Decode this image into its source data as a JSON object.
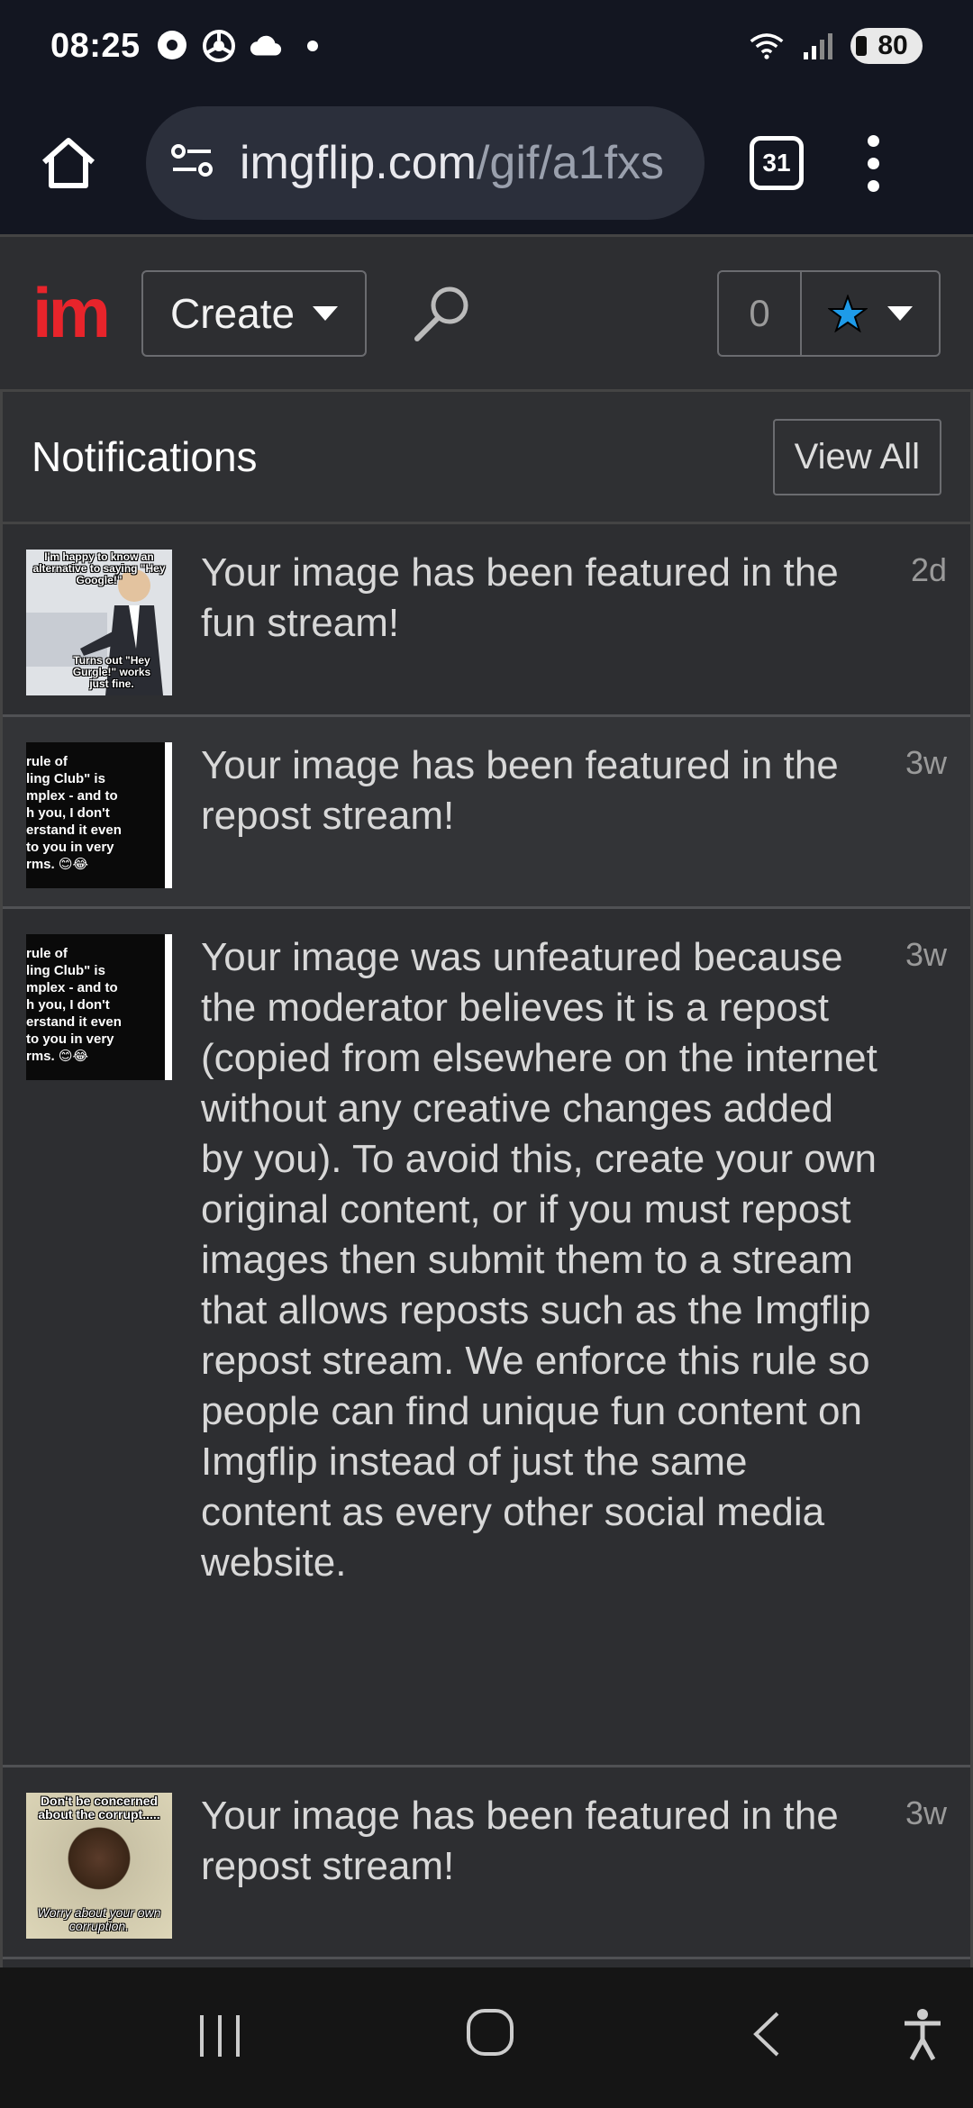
{
  "status_bar": {
    "time": "08:25",
    "battery": "80"
  },
  "browser": {
    "url_host": "imgflip.com",
    "url_path": "/gif/a1fxs",
    "tab_count": "31"
  },
  "site_header": {
    "logo": "im",
    "create_label": "Create",
    "points": "0"
  },
  "notifications": {
    "title": "Notifications",
    "view_all_label": "View All",
    "items": [
      {
        "text": "Your image has been featured in the fun stream!",
        "age": "2d",
        "thumb_top": "I'm happy to know an alternative to saying \"Hey Google!\"",
        "thumb_bottom": "Turns out \"Hey Gurgle!\" works just fine."
      },
      {
        "text": "Your image has been featured in the repost stream!",
        "age": "3w",
        "thumb_lines": [
          "rule of",
          "ling Club\" is",
          "mplex - and to",
          "h you, I don't",
          "erstand it even",
          "to you in very",
          "rms. 😊😂"
        ]
      },
      {
        "text": "Your image was unfeatured because the moderator believes it is a repost (copied from elsewhere on the internet without any creative changes added by you). To avoid this, create your own original content, or if you must repost images then submit them to a stream that allows reposts such as the Imgflip repost stream. We enforce this rule so people can find unique fun content on Imgflip instead of just the same content as every other social media website.",
        "age": "3w",
        "thumb_lines": [
          "rule of",
          "ling Club\" is",
          "mplex - and to",
          "h you, I don't",
          "erstand it even",
          "to you in very",
          "rms. 😊😂"
        ]
      },
      {
        "text": "Your image has been featured in the repost stream!",
        "age": "3w",
        "thumb_top": "Don't be concerned about the corrupt.....",
        "thumb_bottom": "Worry about your own corruption."
      }
    ]
  },
  "colors": {
    "brand_red": "#e8242b",
    "star_blue": "#1e9be9",
    "panel_bg": "#2d2e31"
  }
}
